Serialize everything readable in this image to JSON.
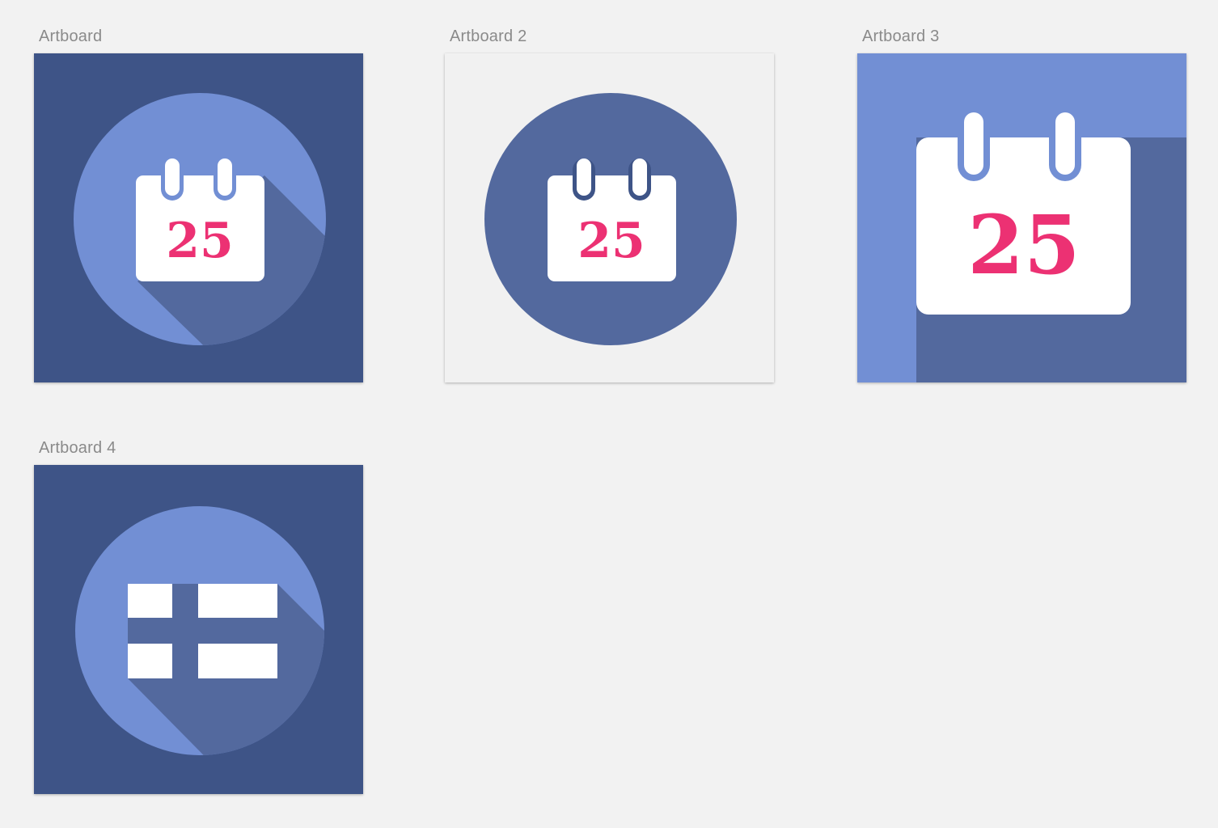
{
  "colors": {
    "canvas_bg": "#f2f2f2",
    "navy": "#3e5487",
    "light_blue": "#728fd4",
    "mid_blue": "#53699e",
    "white": "#ffffff",
    "pink": "#ec3173",
    "artboard2_bg": "#f1f1f1"
  },
  "artboards": [
    {
      "label": "Artboard",
      "icon": "calendar-icon",
      "date": "25"
    },
    {
      "label": "Artboard 2",
      "icon": "calendar-icon",
      "date": "25"
    },
    {
      "label": "Artboard 3",
      "icon": "calendar-icon",
      "date": "25"
    },
    {
      "label": "Artboard 4",
      "icon": "finland-flag-icon"
    }
  ]
}
